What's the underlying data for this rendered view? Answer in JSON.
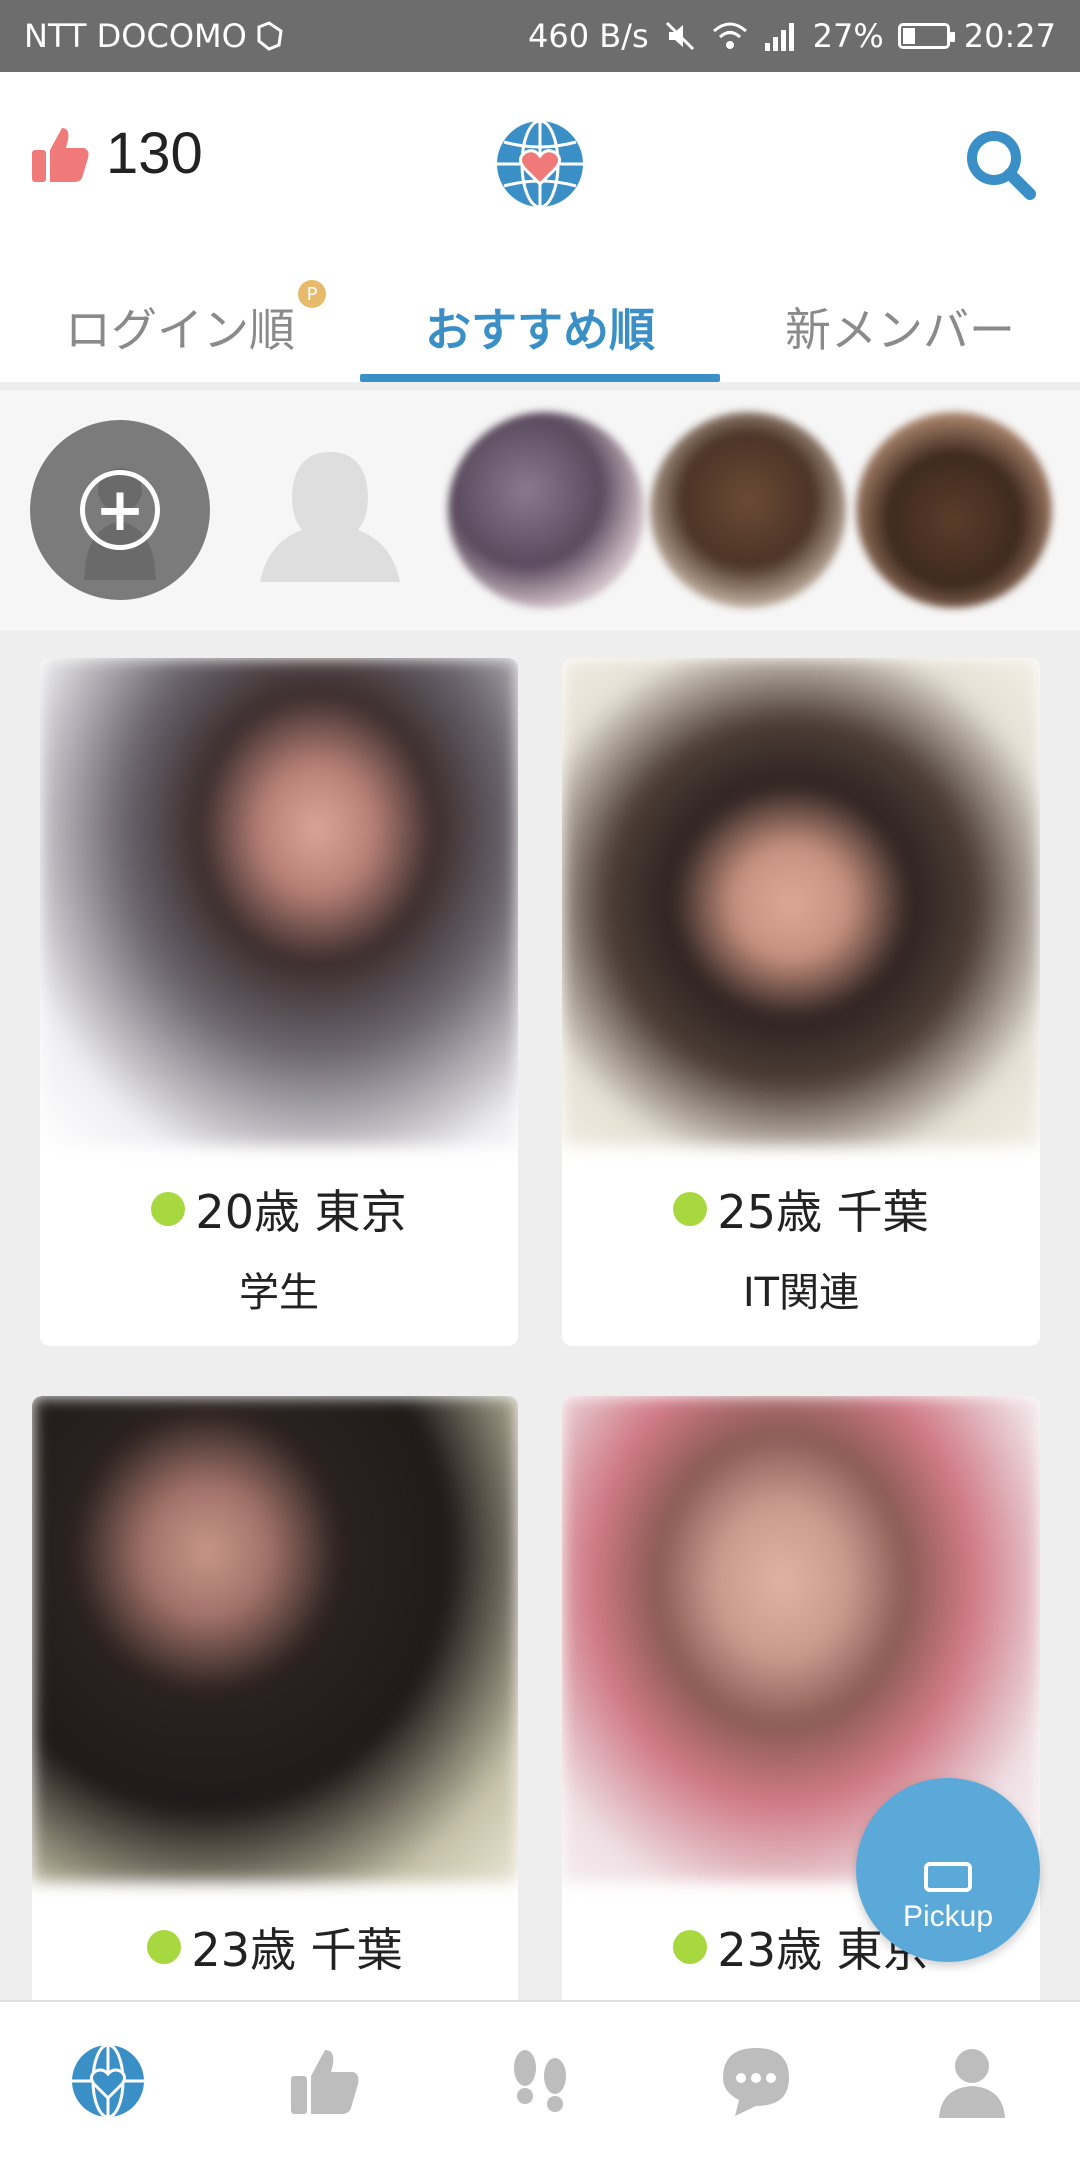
{
  "status_bar": {
    "carrier": "NTT DOCOMO",
    "net_speed": "460 B/s",
    "battery": "27%",
    "battery_level": 0.27,
    "time": "20:27"
  },
  "header": {
    "likes_count": "130",
    "tabs": [
      {
        "label": "ログイン順",
        "badge": "P",
        "active": false
      },
      {
        "label": "おすすめ順",
        "active": true
      },
      {
        "label": "新メンバー",
        "active": false
      }
    ]
  },
  "cards": [
    {
      "age_location": "20歳 東京",
      "occupation": "学生"
    },
    {
      "age_location": "25歳 千葉",
      "occupation": "IT関連"
    },
    {
      "age_location": "23歳 千葉",
      "occupation": ""
    },
    {
      "age_location": "23歳 東京",
      "occupation": ""
    }
  ],
  "fab": {
    "label": "Pickup"
  },
  "colors": {
    "accent": "#3b8fc7",
    "online": "#a7d83f",
    "like": "#f07a7a",
    "fab": "#5aa9d9",
    "nav_icon": "#bdbdbd"
  },
  "icons": {
    "likes": "thumbs-up-icon",
    "logo": "globe-heart-icon",
    "search": "search-icon",
    "add_story": "plus-icon",
    "nav": [
      "globe-heart-icon",
      "thumbs-up-icon",
      "footprints-icon",
      "chat-bubble-icon",
      "profile-icon"
    ]
  }
}
